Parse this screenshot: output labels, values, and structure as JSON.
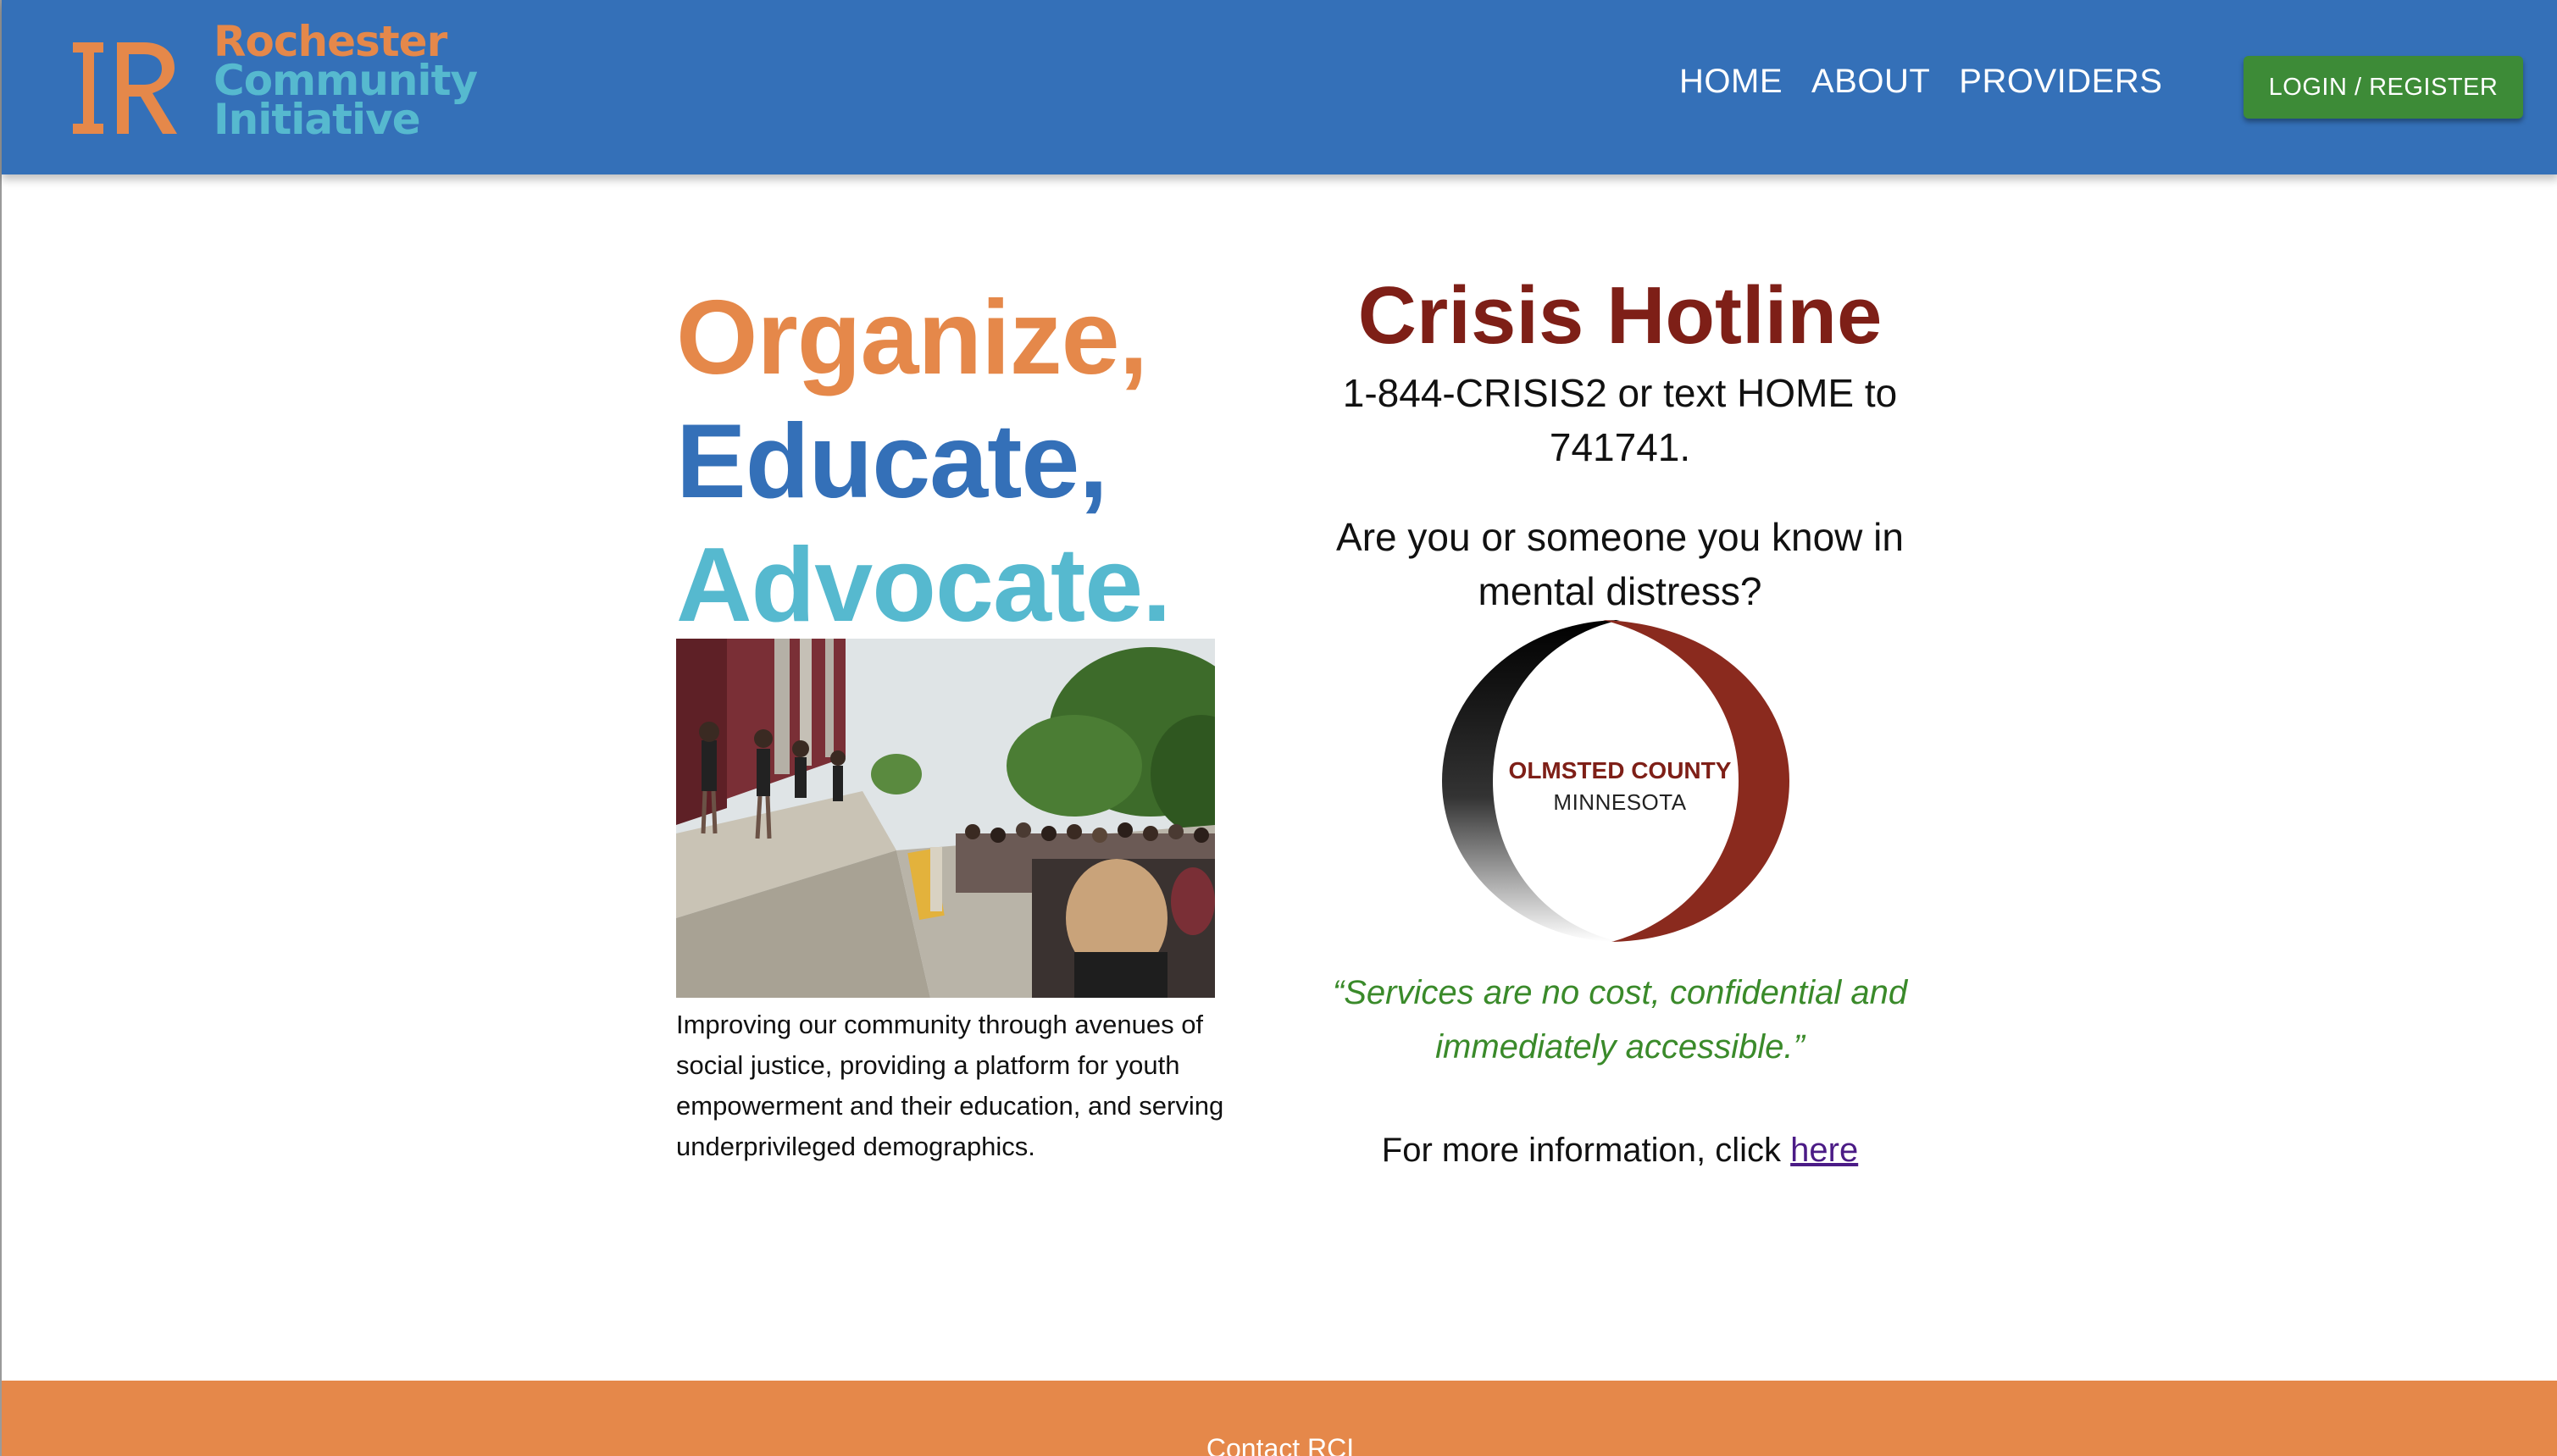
{
  "header": {
    "logo": {
      "line1": "Rochester",
      "line2": "Community",
      "line3": "Initiative"
    },
    "nav": [
      {
        "label": "HOME"
      },
      {
        "label": "ABOUT"
      },
      {
        "label": "PROVIDERS"
      }
    ],
    "login_label": "LOGIN / REGISTER"
  },
  "main": {
    "tagline": {
      "line1": "Organize,",
      "line2": "Educate,",
      "line3": "Advocate."
    },
    "mission": "Improving our community through avenues of social justice, providing a platform for youth empowerment and their education, and serving underprivileged demographics.",
    "hotline": {
      "title": "Crisis Hotline",
      "number_text": "1-844-CRISIS2 or text HOME to 741741.",
      "question": "Are you or someone you know in mental distress?",
      "county_logo": {
        "line1": "OLMSTED COUNTY",
        "line2": "MINNESOTA"
      },
      "quote": "“Services are no cost, confidential and immediately accessible.”",
      "more_info_prefix": "For more information, click ",
      "more_info_link": "here"
    }
  },
  "footer": {
    "contact_label": "Contact RCI"
  },
  "colors": {
    "header_bg": "#3470b8",
    "orange": "#e5884a",
    "teal": "#56b9cf",
    "blue": "#3470b8",
    "crisis_red": "#7e1f17",
    "quote_green": "#3a8a2a",
    "login_green": "#3d8b37"
  },
  "icons": [
    "rci-logo-icon",
    "olmsted-county-logo-icon"
  ]
}
